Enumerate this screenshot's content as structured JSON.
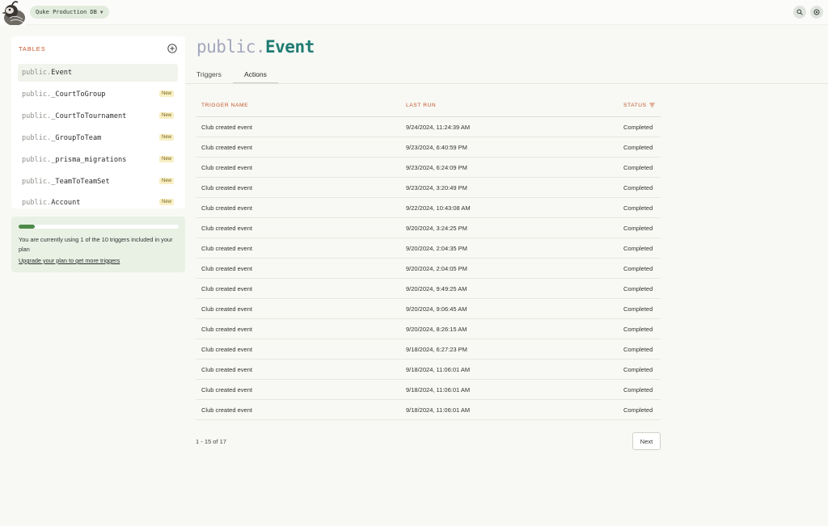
{
  "header": {
    "db_selector": "Quke Production DB",
    "icons": [
      "search-icon",
      "settings-icon"
    ]
  },
  "sidebar": {
    "heading": "TABLES",
    "items": [
      {
        "schema": "public.",
        "name": "Event",
        "badge": "",
        "active": true
      },
      {
        "schema": "public.",
        "name": "_CourtToGroup",
        "badge": "New"
      },
      {
        "schema": "public.",
        "name": "_CourtToTournament",
        "badge": "New"
      },
      {
        "schema": "public.",
        "name": "_GroupToTeam",
        "badge": "New"
      },
      {
        "schema": "public.",
        "name": "_prisma_migrations",
        "badge": "New"
      },
      {
        "schema": "public.",
        "name": "_TeamToTeamSet",
        "badge": "New"
      },
      {
        "schema": "public.",
        "name": "Account",
        "badge": "New"
      }
    ]
  },
  "usage": {
    "progress_fraction": 0.1,
    "text": "You are currently using 1 of the 10 triggers included in your plan",
    "link": "Upgrade your plan to get more triggers"
  },
  "main": {
    "title_schema": "public.",
    "title_table": "Event",
    "tabs": [
      {
        "label": "Triggers",
        "active": false
      },
      {
        "label": "Actions",
        "active": true
      }
    ],
    "columns": {
      "name": "TRIGGER NAME",
      "last_run": "LAST RUN",
      "status": "STATUS"
    },
    "rows": [
      {
        "name": "Club created event",
        "last_run": "9/24/2024, 11:24:39 AM",
        "status": "Completed"
      },
      {
        "name": "Club created event",
        "last_run": "9/23/2024, 6:40:59 PM",
        "status": "Completed"
      },
      {
        "name": "Club created event",
        "last_run": "9/23/2024, 6:24:09 PM",
        "status": "Completed"
      },
      {
        "name": "Club created event",
        "last_run": "9/23/2024, 3:20:49 PM",
        "status": "Completed"
      },
      {
        "name": "Club created event",
        "last_run": "9/22/2024, 10:43:08 AM",
        "status": "Completed"
      },
      {
        "name": "Club created event",
        "last_run": "9/20/2024, 3:24:25 PM",
        "status": "Completed"
      },
      {
        "name": "Club created event",
        "last_run": "9/20/2024, 2:04:35 PM",
        "status": "Completed"
      },
      {
        "name": "Club created event",
        "last_run": "9/20/2024, 2:04:05 PM",
        "status": "Completed"
      },
      {
        "name": "Club created event",
        "last_run": "9/20/2024, 9:49:25 AM",
        "status": "Completed"
      },
      {
        "name": "Club created event",
        "last_run": "9/20/2024, 9:06:45 AM",
        "status": "Completed"
      },
      {
        "name": "Club created event",
        "last_run": "9/20/2024, 8:26:15 AM",
        "status": "Completed"
      },
      {
        "name": "Club created event",
        "last_run": "9/18/2024, 6:27:23 PM",
        "status": "Completed"
      },
      {
        "name": "Club created event",
        "last_run": "9/18/2024, 11:06:01 AM",
        "status": "Completed"
      },
      {
        "name": "Club created event",
        "last_run": "9/18/2024, 11:06:01 AM",
        "status": "Completed"
      },
      {
        "name": "Club created event",
        "last_run": "9/18/2024, 11:06:01 AM",
        "status": "Completed"
      }
    ],
    "pagination": {
      "info": "1 - 15 of 17",
      "next_label": "Next"
    }
  },
  "colors": {
    "accent_orange": "#c4552b",
    "title_teal": "#1f7b73",
    "progress_green": "#4f8a4b",
    "badge_yellow": "#f8efc3"
  }
}
